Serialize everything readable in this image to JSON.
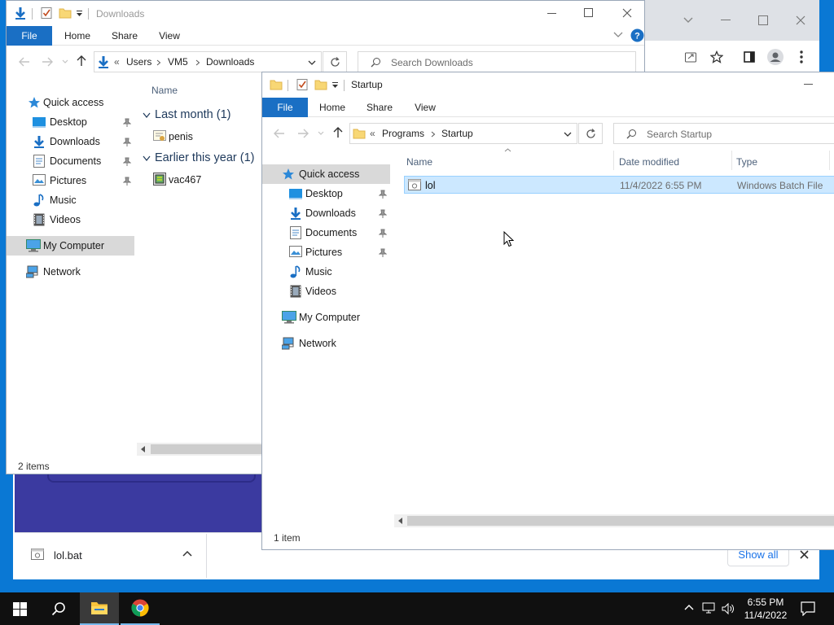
{
  "taskbar": {
    "clock_time": "6:55 PM",
    "clock_date": "11/4/2022"
  },
  "chrome": {
    "download_item": "lol.bat",
    "show_all": "Show all"
  },
  "explorer_downloads": {
    "title": "Downloads",
    "tabs": [
      "File",
      "Home",
      "Share",
      "View"
    ],
    "breadcrumb": [
      "Users",
      "VM5",
      "Downloads"
    ],
    "search_placeholder": "Search Downloads",
    "column_name": "Name",
    "groups": [
      {
        "label": "Last month (1)",
        "files": [
          "penis"
        ]
      },
      {
        "label": "Earlier this year (1)",
        "files": [
          "vac467"
        ]
      }
    ],
    "nav": {
      "quick_access": "Quick access",
      "items": [
        "Desktop",
        "Downloads",
        "Documents",
        "Pictures",
        "Music",
        "Videos"
      ],
      "my_computer": "My Computer",
      "network": "Network"
    },
    "status": "2 items"
  },
  "explorer_startup": {
    "title": "Startup",
    "tabs": [
      "File",
      "Home",
      "Share",
      "View"
    ],
    "breadcrumb": [
      "Programs",
      "Startup"
    ],
    "search_placeholder": "Search Startup",
    "columns": [
      "Name",
      "Date modified",
      "Type"
    ],
    "rows": [
      {
        "name": "lol",
        "date": "11/4/2022 6:55 PM",
        "type": "Windows Batch File"
      }
    ],
    "nav": {
      "quick_access": "Quick access",
      "items": [
        "Desktop",
        "Downloads",
        "Documents",
        "Pictures",
        "Music",
        "Videos"
      ],
      "my_computer": "My Computer",
      "network": "Network"
    },
    "status": "1 item"
  },
  "colors": {
    "desktop": "#0a78d4",
    "ribbon_file": "#1a6fc4",
    "selection": "#cce8ff",
    "taskbar": "#101010"
  }
}
